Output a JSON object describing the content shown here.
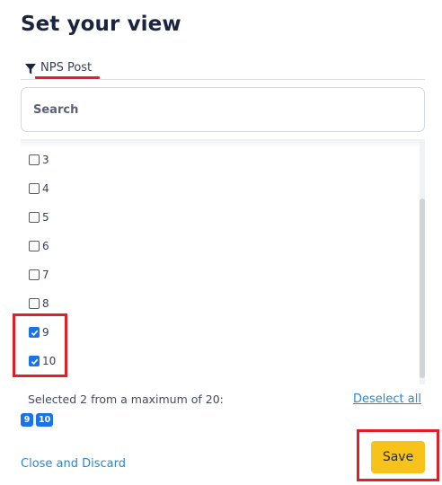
{
  "header": {
    "title": "Set your view"
  },
  "filter": {
    "label": "NPS Post",
    "icon": "funnel-icon"
  },
  "search": {
    "placeholder": "Search",
    "value": ""
  },
  "options": [
    {
      "label": "3",
      "checked": false
    },
    {
      "label": "4",
      "checked": false
    },
    {
      "label": "5",
      "checked": false
    },
    {
      "label": "6",
      "checked": false
    },
    {
      "label": "7",
      "checked": false
    },
    {
      "label": "8",
      "checked": false
    },
    {
      "label": "9",
      "checked": true
    },
    {
      "label": "10",
      "checked": true
    }
  ],
  "selection": {
    "summary": "Selected 2 from a maximum of 20:",
    "deselect_label": "Deselect all",
    "chips": [
      "9",
      "10"
    ]
  },
  "footer": {
    "close_label": "Close and Discard",
    "save_label": "Save"
  },
  "colors": {
    "accent": "#1a73e8",
    "link": "#2a86d6",
    "save": "#f7c31a",
    "annotation": "#e01f26"
  }
}
